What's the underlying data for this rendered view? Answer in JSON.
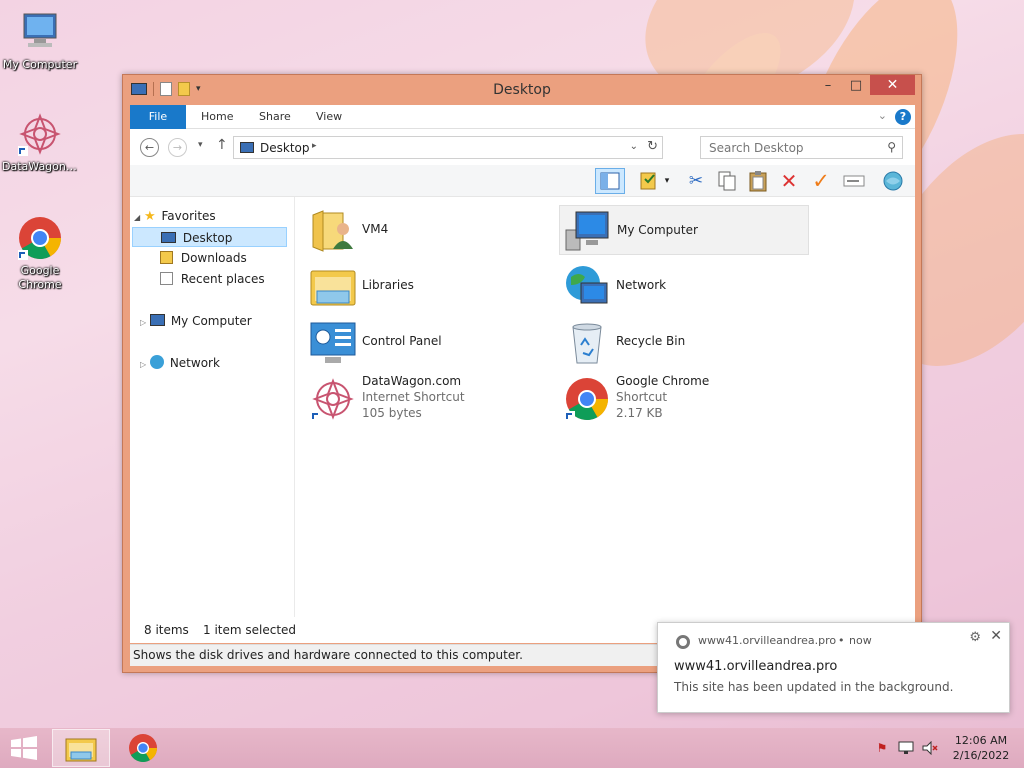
{
  "desktop": {
    "icons": [
      {
        "label": "My Computer",
        "icon": "computer-icon"
      },
      {
        "label": "DataWagon....",
        "icon": "datawagon-icon"
      },
      {
        "label": "Google Chrome",
        "icon": "chrome-icon"
      }
    ]
  },
  "window": {
    "title": "Desktop",
    "minimize": "–",
    "maximize": "□",
    "close": "✕",
    "ribbon_tabs": [
      "File",
      "Home",
      "Share",
      "View"
    ],
    "address": "Desktop",
    "search_placeholder": "Search Desktop",
    "nav": {
      "favorites": "Favorites",
      "desktop": "Desktop",
      "downloads": "Downloads",
      "recent": "Recent places",
      "my_computer": "My Computer",
      "network": "Network"
    },
    "items": [
      {
        "name": "VM4",
        "sub1": "",
        "sub2": ""
      },
      {
        "name": "My Computer",
        "sub1": "",
        "sub2": ""
      },
      {
        "name": "Libraries",
        "sub1": "",
        "sub2": ""
      },
      {
        "name": "Network",
        "sub1": "",
        "sub2": ""
      },
      {
        "name": "Control Panel",
        "sub1": "",
        "sub2": ""
      },
      {
        "name": "Recycle Bin",
        "sub1": "",
        "sub2": ""
      },
      {
        "name": "DataWagon.com",
        "sub1": "Internet Shortcut",
        "sub2": "105 bytes"
      },
      {
        "name": "Google Chrome",
        "sub1": "Shortcut",
        "sub2": "2.17 KB"
      }
    ],
    "status_count": "8 items",
    "status_selected": "1 item selected",
    "status_tip": "Shows the disk drives and hardware connected to this computer."
  },
  "notification": {
    "source": "www41.orvilleandrea.pro",
    "time": "now",
    "title": "www41.orvilleandrea.pro",
    "body": "This site has been updated in the background."
  },
  "taskbar": {
    "time": "12:06 AM",
    "date": "2/16/2022"
  },
  "colors": {
    "accent": "#1979ca",
    "window_frame": "#eba07f",
    "close_button": "#c7504c",
    "selection": "#cce8ff"
  }
}
